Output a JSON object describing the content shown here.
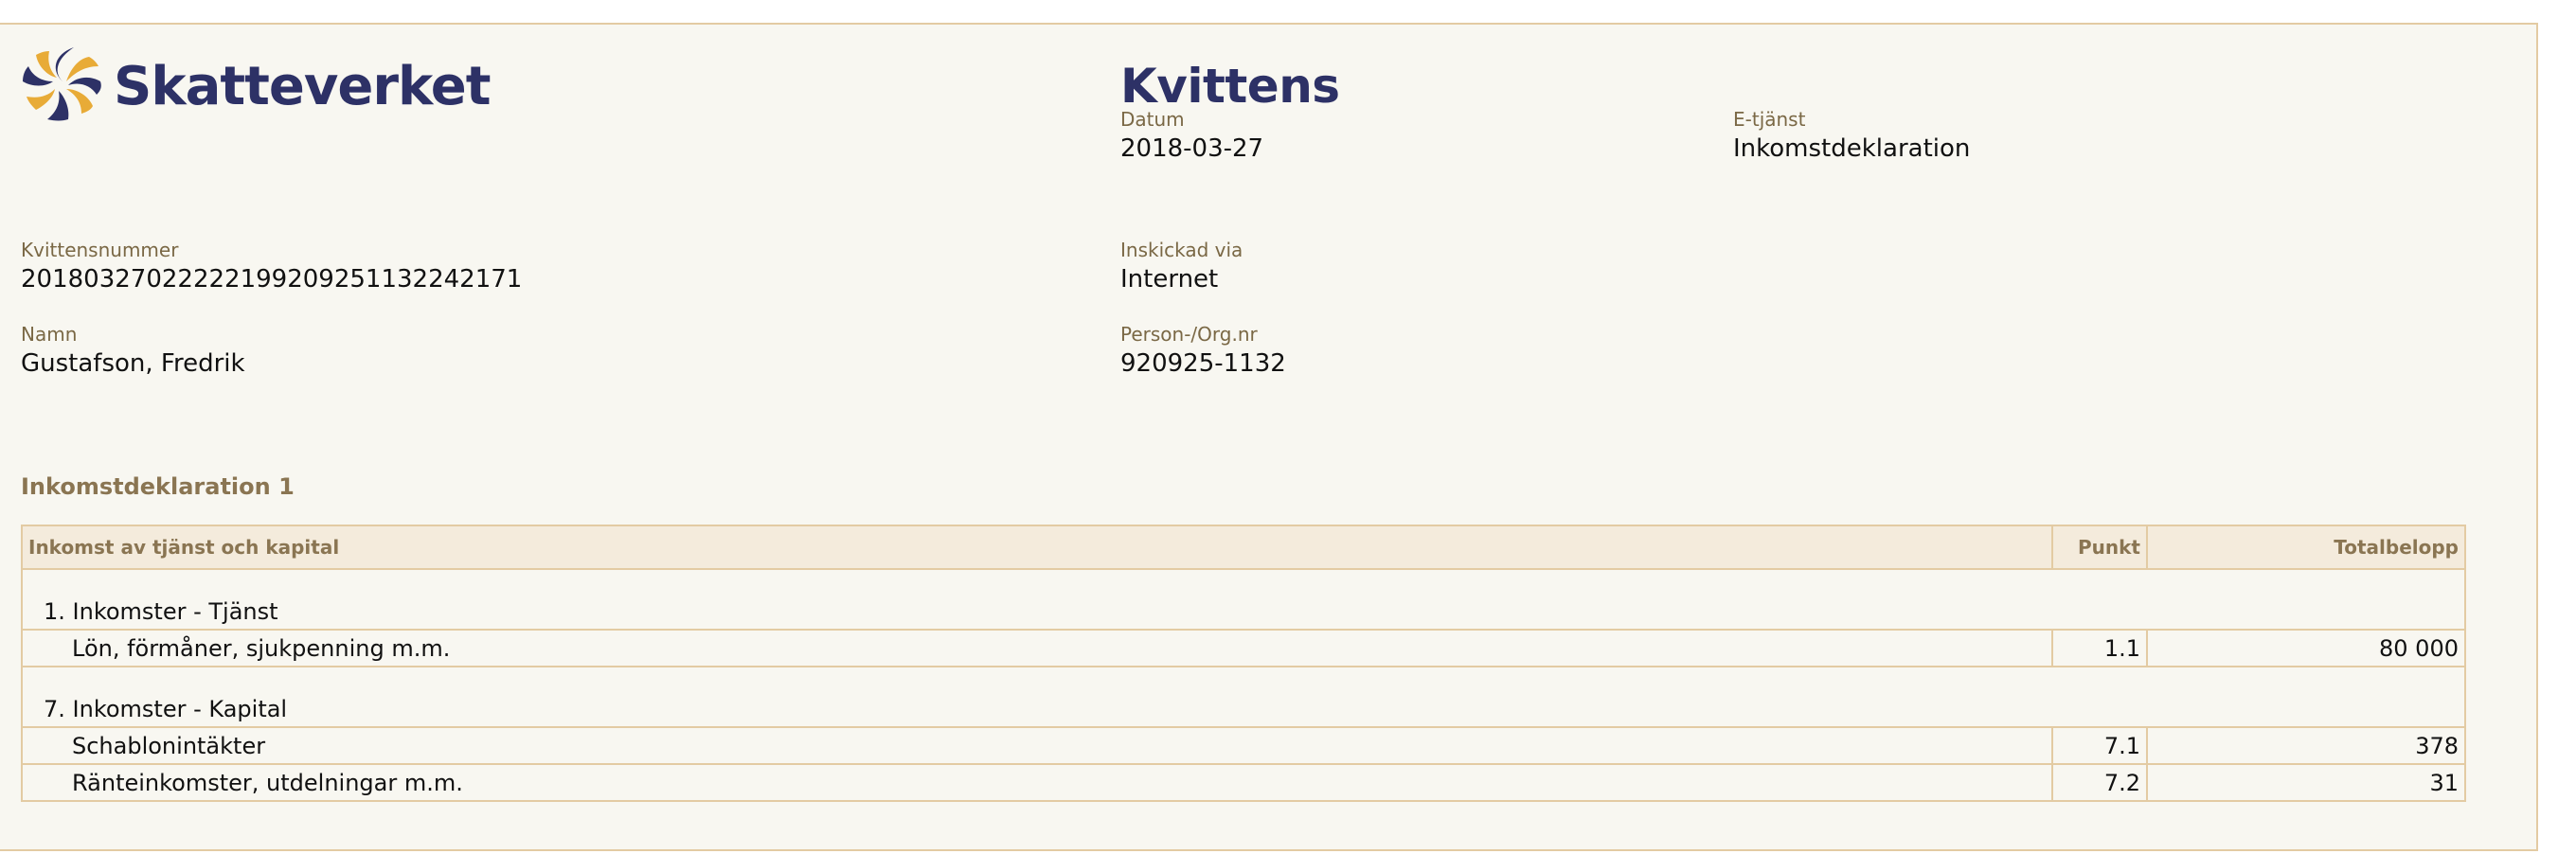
{
  "brand": {
    "name": "Skatteverket",
    "logo_icon": "skatteverket-swirl-logo",
    "colors": {
      "navy": "#2d3166",
      "gold": "#e8ab37",
      "border": "#e3cba3",
      "label": "#7a6845"
    }
  },
  "document": {
    "title": "Kvittens"
  },
  "fields": {
    "datum": {
      "label": "Datum",
      "value": "2018-03-27"
    },
    "etjanst": {
      "label": "E-tjänst",
      "value": "Inkomstdeklaration"
    },
    "kvittensnummer": {
      "label": "Kvittensnummer",
      "value": "20180327022222199209251132242171"
    },
    "inskickad_via": {
      "label": "Inskickad via",
      "value": "Internet"
    },
    "namn": {
      "label": "Namn",
      "value": "Gustafson, Fredrik"
    },
    "person_org_nr": {
      "label": "Person-/Org.nr",
      "value": "920925-1132"
    }
  },
  "section": {
    "heading": "Inkomstdeklaration 1",
    "table": {
      "headers": {
        "description": "Inkomst av tjänst och kapital",
        "punkt": "Punkt",
        "total": "Totalbelopp"
      },
      "groups": [
        {
          "title": "1. Inkomster - Tjänst",
          "rows": [
            {
              "description": "Lön, förmåner, sjukpenning m.m.",
              "punkt": "1.1",
              "total": "80 000"
            }
          ]
        },
        {
          "title": "7. Inkomster - Kapital",
          "rows": [
            {
              "description": "Schablonintäkter",
              "punkt": "7.1",
              "total": "378"
            },
            {
              "description": "Ränteinkomster, utdelningar m.m.",
              "punkt": "7.2",
              "total": "31"
            }
          ]
        }
      ]
    }
  }
}
